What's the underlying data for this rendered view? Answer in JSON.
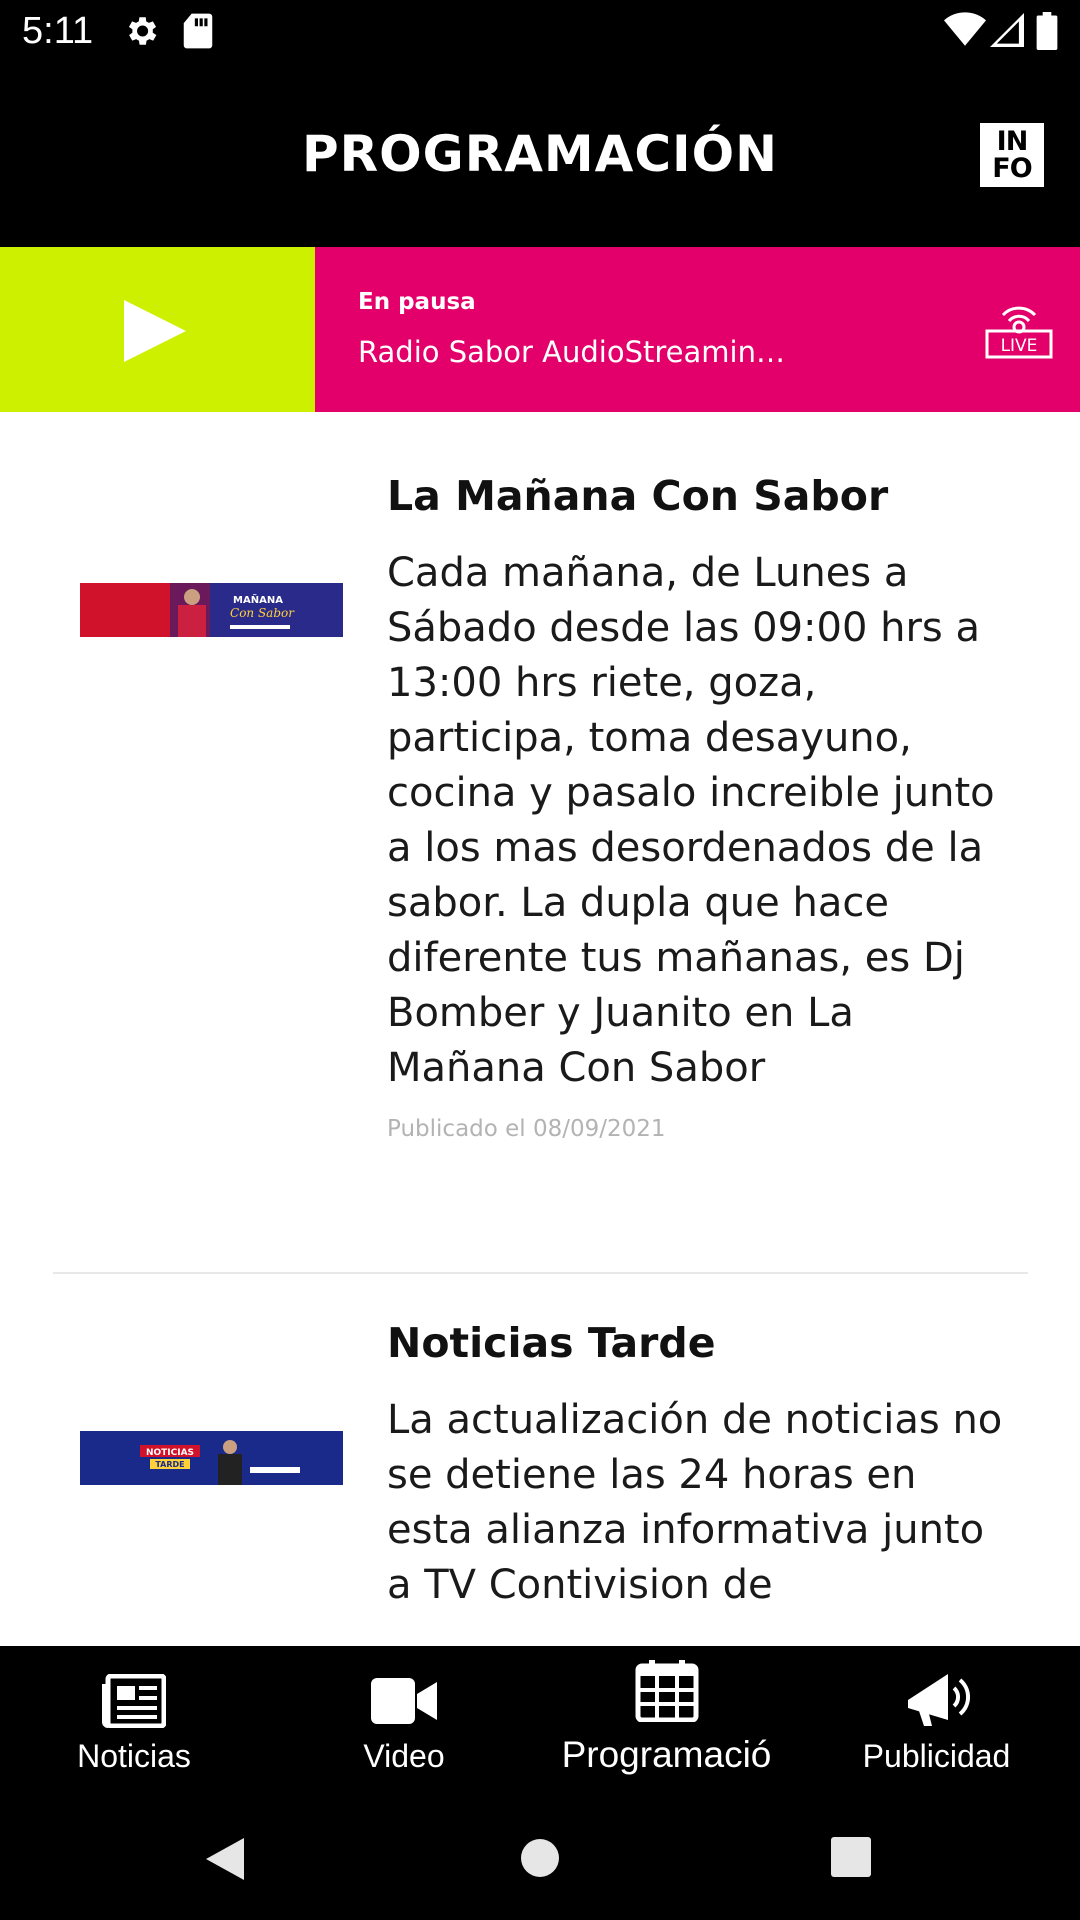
{
  "status_bar": {
    "time": "5:11",
    "icons": [
      "settings-gear-icon",
      "sd-card-icon",
      "wifi-icon",
      "cell-signal-icon",
      "battery-icon"
    ]
  },
  "header": {
    "title": "PROGRAMACIÓN",
    "logo_text_top": "IN",
    "logo_text_bottom": "FO"
  },
  "player": {
    "status": "En pausa",
    "track": "Radio Sabor AudioStreamin…",
    "live_label": "LIVE",
    "colors": {
      "play_bg": "#cdf000",
      "info_bg": "#e3006b"
    }
  },
  "programs": [
    {
      "title": "La Mañana Con Sabor",
      "description": "Cada mañana, de Lunes a Sábado desde las 09:00 hrs a 13:00 hrs riete, goza, participa, toma desayuno, cocina y pasalo increible junto a los mas desordenados de la sabor. La dupla que hace diferente tus mañanas, es Dj Bomber y Juanito en La Mañana Con Sabor",
      "date": "Publicado el 08/09/2021",
      "thumb_text": "MAÑANA Con Sabor"
    },
    {
      "title": "Noticias Tarde",
      "description": "La actualización de noticias no se detiene las 24 horas en esta alianza informativa junto a TV Contivision de",
      "thumb_text": "NOTICIAS TARDE"
    }
  ],
  "bottom_nav": {
    "items": [
      {
        "label": "Noticias",
        "icon": "newspaper-icon"
      },
      {
        "label": "Video",
        "icon": "video-camera-icon"
      },
      {
        "label": "Programació",
        "icon": "calendar-icon"
      },
      {
        "label": "Publicidad",
        "icon": "megaphone-icon"
      }
    ]
  }
}
